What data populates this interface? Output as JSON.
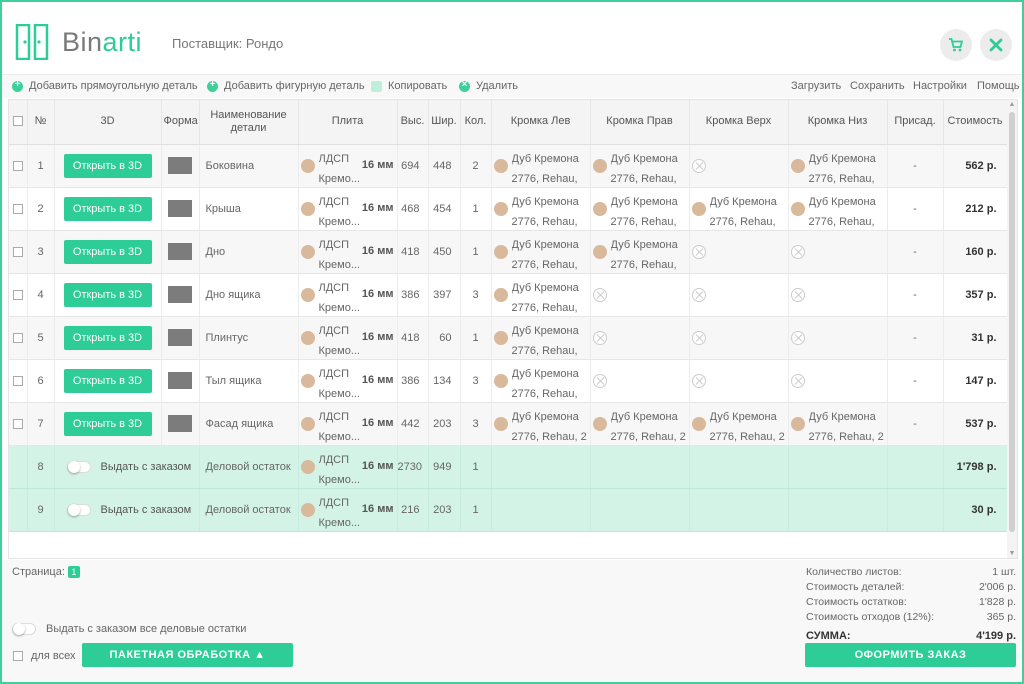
{
  "header": {
    "brand_main": "Bin",
    "brand_accent": "arti",
    "supplier": "Поставщик: Рондо"
  },
  "toolbar": {
    "add_rect": "Добавить прямоугольную деталь",
    "add_shaped": "Добавить фигурную деталь",
    "copy": "Копировать",
    "delete": "Удалить",
    "load": "Загрузить",
    "save": "Сохранить",
    "settings": "Настройки",
    "help": "Помощь"
  },
  "columns": {
    "num": "№",
    "view3d": "3D",
    "shape": "Форма",
    "name": "Наименование детали",
    "plate": "Плита",
    "height": "Выс.",
    "width": "Шир.",
    "qty": "Кол.",
    "edge_left": "Кромка Лев",
    "edge_right": "Кромка Прав",
    "edge_top": "Кромка Верх",
    "edge_bottom": "Кромка Низ",
    "addit": "Присад.",
    "cost": "Стоимость"
  },
  "open3d_label": "Открыть в 3D",
  "issue_label": "Выдать с заказом",
  "rows": [
    {
      "num": "1",
      "name": "Боковина",
      "mat": "ЛДСП\nКремо...",
      "thick": "16 мм",
      "h": "694",
      "w": "448",
      "qty": "2",
      "el": "Дуб Кремона\n2776, Rehau,",
      "er": "Дуб Кремона\n2776, Rehau,",
      "et": "",
      "eb": "Дуб Кремона\n2776, Rehau,",
      "addit": "-",
      "cost": "562 р."
    },
    {
      "num": "2",
      "name": "Крыша",
      "mat": "ЛДСП\nКремо...",
      "thick": "16 мм",
      "h": "468",
      "w": "454",
      "qty": "1",
      "el": "Дуб Кремона\n2776, Rehau,",
      "er": "Дуб Кремона\n2776, Rehau,",
      "et": "Дуб Кремона\n2776, Rehau,",
      "eb": "Дуб Кремона\n2776, Rehau,",
      "addit": "-",
      "cost": "212 р."
    },
    {
      "num": "3",
      "name": "Дно",
      "mat": "ЛДСП\nКремо...",
      "thick": "16 мм",
      "h": "418",
      "w": "450",
      "qty": "1",
      "el": "Дуб Кремона\n2776, Rehau,",
      "er": "Дуб Кремона\n2776, Rehau,",
      "et": "",
      "eb": "",
      "addit": "-",
      "cost": "160 р."
    },
    {
      "num": "4",
      "name": "Дно ящика",
      "mat": "ЛДСП\nКремо...",
      "thick": "16 мм",
      "h": "386",
      "w": "397",
      "qty": "3",
      "el": "Дуб Кремона\n2776, Rehau,",
      "er": "",
      "et": "",
      "eb": "",
      "addit": "-",
      "cost": "357 р."
    },
    {
      "num": "5",
      "name": "Плинтус",
      "mat": "ЛДСП\nКремо...",
      "thick": "16 мм",
      "h": "418",
      "w": "60",
      "qty": "1",
      "el": "Дуб Кремона\n2776, Rehau,",
      "er": "",
      "et": "",
      "eb": "",
      "addit": "-",
      "cost": "31 р."
    },
    {
      "num": "6",
      "name": "Тыл ящика",
      "mat": "ЛДСП\nКремо...",
      "thick": "16 мм",
      "h": "386",
      "w": "134",
      "qty": "3",
      "el": "Дуб Кремона\n2776, Rehau,",
      "er": "",
      "et": "",
      "eb": "",
      "addit": "-",
      "cost": "147 р."
    },
    {
      "num": "7",
      "name": "Фасад ящика",
      "mat": "ЛДСП\nКремо...",
      "thick": "16 мм",
      "h": "442",
      "w": "203",
      "qty": "3",
      "el": "Дуб Кремона\n2776, Rehau, 2 х",
      "er": "Дуб Кремона\n2776, Rehau, 2 х",
      "et": "Дуб Кремона\n2776, Rehau, 2 х",
      "eb": "Дуб Кремона\n2776, Rehau, 2 х",
      "addit": "-",
      "cost": "537 р."
    }
  ],
  "remnants": [
    {
      "num": "8",
      "name": "Деловой остаток",
      "mat": "ЛДСП\nКремо...",
      "thick": "16 мм",
      "h": "2730",
      "w": "949",
      "qty": "1",
      "cost": "1'798 р."
    },
    {
      "num": "9",
      "name": "Деловой остаток",
      "mat": "ЛДСП\nКремо...",
      "thick": "16 мм",
      "h": "216",
      "w": "203",
      "qty": "1",
      "cost": "30 р."
    }
  ],
  "footer": {
    "page_label": "Страница:",
    "page_num": "1",
    "issue_all_label": "Выдать с заказом все деловые остатки",
    "for_all_label": "для всех",
    "batch_label": "ПАКЕТНАЯ ОБРАБОТКА ▲",
    "order_label": "ОФОРМИТЬ ЗАКАЗ"
  },
  "summary": {
    "sheets_label": "Количество листов:",
    "sheets_value": "1 шт.",
    "parts_label": "Стоимость деталей:",
    "parts_value": "2'006 р.",
    "rest_label": "Стоимость остатков:",
    "rest_value": "1'828 р.",
    "waste_label": "Стоимость отходов (12%):",
    "waste_value": "365 р.",
    "total_label": "СУММА:",
    "total_value": "4'199 р."
  },
  "colors": {
    "accent": "#2ecc96",
    "remnant_row": "#d3f3e6",
    "swatch": "#d9b99b"
  }
}
